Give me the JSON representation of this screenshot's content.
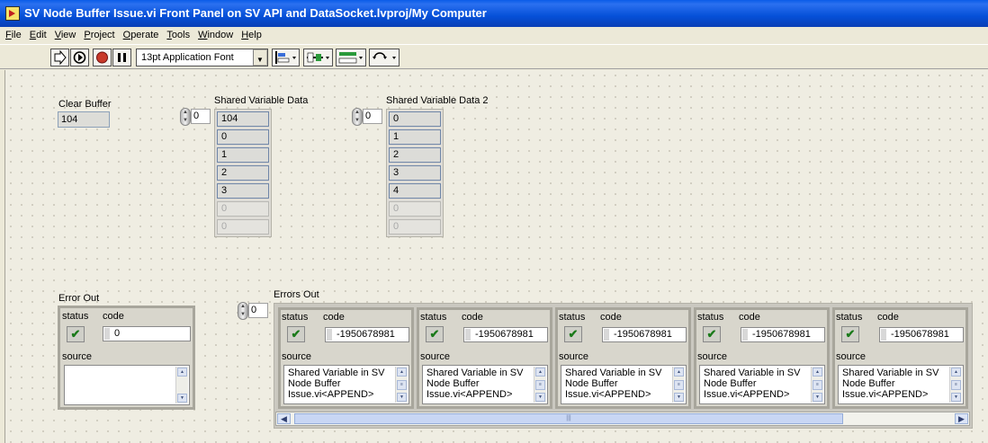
{
  "window": {
    "title": "SV Node Buffer Issue.vi Front Panel on SV API and DataSocket.lvproj/My Computer"
  },
  "menu": [
    "File",
    "Edit",
    "View",
    "Project",
    "Operate",
    "Tools",
    "Window",
    "Help"
  ],
  "toolbar": {
    "font": "13pt Application Font"
  },
  "clear_buffer": {
    "label": "Clear Buffer",
    "value": "104"
  },
  "sv_data": {
    "label": "Shared Variable Data",
    "index": "0",
    "values": [
      "104",
      "0",
      "1",
      "2",
      "3"
    ],
    "empty": [
      "0",
      "0"
    ]
  },
  "sv_data2": {
    "label": "Shared Variable Data 2",
    "index": "0",
    "values": [
      "0",
      "1",
      "2",
      "3",
      "4"
    ],
    "empty": [
      "0",
      "0"
    ]
  },
  "error_out": {
    "label": "Error Out",
    "status_label": "status",
    "code_label": "code",
    "source_label": "source",
    "code": "0",
    "source": ""
  },
  "errors_out": {
    "label": "Errors Out",
    "index": "0",
    "items": [
      {
        "status_label": "status",
        "code_label": "code",
        "source_label": "source",
        "code": "-1950678981",
        "source": "Shared Variable in SV Node Buffer Issue.vi<APPEND>"
      },
      {
        "status_label": "status",
        "code_label": "code",
        "source_label": "source",
        "code": "-1950678981",
        "source": "Shared Variable in SV Node Buffer Issue.vi<APPEND>"
      },
      {
        "status_label": "status",
        "code_label": "code",
        "source_label": "source",
        "code": "-1950678981",
        "source": "Shared Variable in SV Node Buffer Issue.vi<APPEND>"
      },
      {
        "status_label": "status",
        "code_label": "code",
        "source_label": "source",
        "code": "-1950678981",
        "source": "Shared Variable in SV Node Buffer Issue.vi<APPEND>"
      },
      {
        "status_label": "status",
        "code_label": "code",
        "source_label": "source",
        "code": "-1950678981",
        "source": "Shared Variable in SV Node Buffer Issue.vi<APPEND>"
      }
    ]
  }
}
